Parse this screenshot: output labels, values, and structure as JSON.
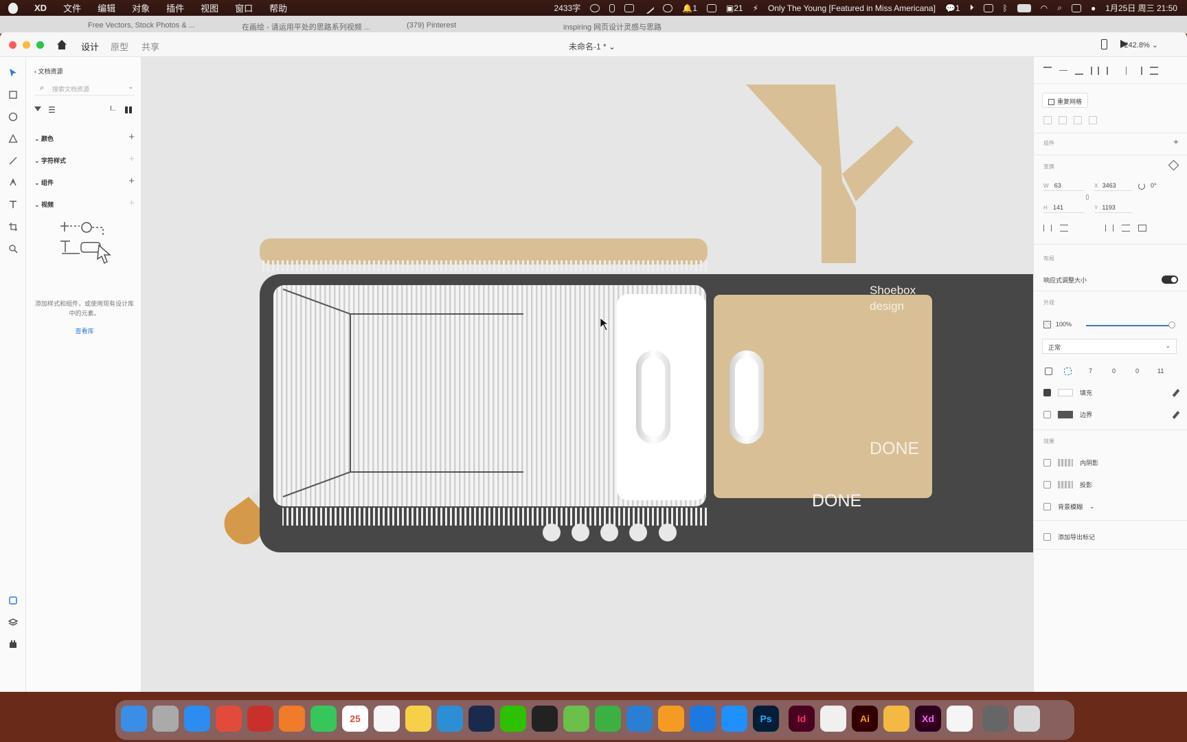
{
  "menubar": {
    "app": "XD",
    "menus": [
      "文件",
      "编辑",
      "对象",
      "插件",
      "视图",
      "窗口",
      "帮助"
    ],
    "wordcount": "2433字",
    "music": "Only The Young [Featured in Miss Americana]",
    "wechat_count": "1",
    "notif_count": "1",
    "badge_21": "21",
    "datetime": "1月25日 周三  21:50"
  },
  "browser_tabs": [
    "Free Vectors, Stock Photos & ...",
    "在画绘 - 请运用平处的思路系列视频 ...",
    "(379) Pinterest",
    "inspiring 网页设计灵感与思路"
  ],
  "window": {
    "tabs": [
      "设计",
      "原型",
      "共享"
    ],
    "doc_title": "未命名-1 *",
    "zoom": "242.8%"
  },
  "assets": {
    "back_label": "文档资源",
    "search_placeholder": "搜索文档资源",
    "sections": [
      "颜色",
      "字符样式",
      "组件",
      "视频"
    ],
    "empty_text": "添加样式和组件，或使用现有设计库中的元素。",
    "empty_link": "查看库"
  },
  "canvas": {
    "shoebox_title": "Shoebox\ndesign",
    "done_card": "DONE",
    "done_bar": "DONE",
    "colors": {
      "tan": "#d8bf96",
      "dark": "#474747",
      "orange": "#d49a4a",
      "bg": "#e6e6e6"
    }
  },
  "inspector": {
    "repeat_grid": "重复网格",
    "components": "组件",
    "transform": "变换",
    "w": "63",
    "x": "3463",
    "rotate": "0°",
    "h": "141",
    "y": "1193",
    "layout": "布局",
    "responsive": "响应式调整大小",
    "appearance": "外观",
    "opacity": "100%",
    "blend": "正常",
    "radius": [
      "7",
      "0",
      "0",
      "11"
    ],
    "fill": "填充",
    "border": "边界",
    "effects": "效果",
    "inner_shadow": "内阴影",
    "drop_shadow": "投影",
    "bg_blur": "背景模糊",
    "export_mark": "添加导出标记"
  },
  "dock": [
    "Finder",
    "Launchpad",
    "Safari",
    "Chrome",
    "Opera",
    "Firefox",
    "FaceTime",
    "25",
    "Reminders",
    "Notes",
    "Edge",
    "QuickTime",
    "WeChat",
    "QQ",
    "Boot",
    "Numbers",
    "Keynote",
    "Pages",
    "Xcode",
    "Lightning",
    "Ps",
    "Id",
    "Sketch",
    "Ai",
    "Slack",
    "Xd",
    "Preview",
    "Screen",
    "Trash"
  ]
}
